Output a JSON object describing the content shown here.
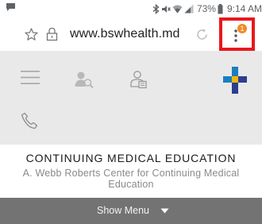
{
  "status_bar": {
    "battery": "73%",
    "time": "9:14 AM",
    "icons": [
      "chat-notification-icon",
      "bluetooth-icon",
      "mute-icon",
      "wifi-icon",
      "signal-icon",
      "battery-icon"
    ]
  },
  "browser": {
    "url": "www.bswhealth.md",
    "icons": [
      "star-icon",
      "lock-icon",
      "reload-icon",
      "more-vert-icon"
    ],
    "notification_badge": "1",
    "highlight_color": "#e8181d",
    "badge_color": "#f08a24"
  },
  "site_header": {
    "icons": [
      "hamburger-menu-icon",
      "find-doctor-icon",
      "patient-portal-icon",
      "bsw-cross-logo",
      "phone-icon"
    ],
    "logo_colors": [
      "#1a7fc1",
      "#f5b700",
      "#2c3e8f"
    ]
  },
  "page": {
    "title": "CONTINUING MEDICAL EDUCATION",
    "subtitle": "A. Webb Roberts Center for Continuing Medical Education"
  },
  "menu_bar": {
    "label": "Show Menu",
    "icon": "caret-down-icon"
  }
}
